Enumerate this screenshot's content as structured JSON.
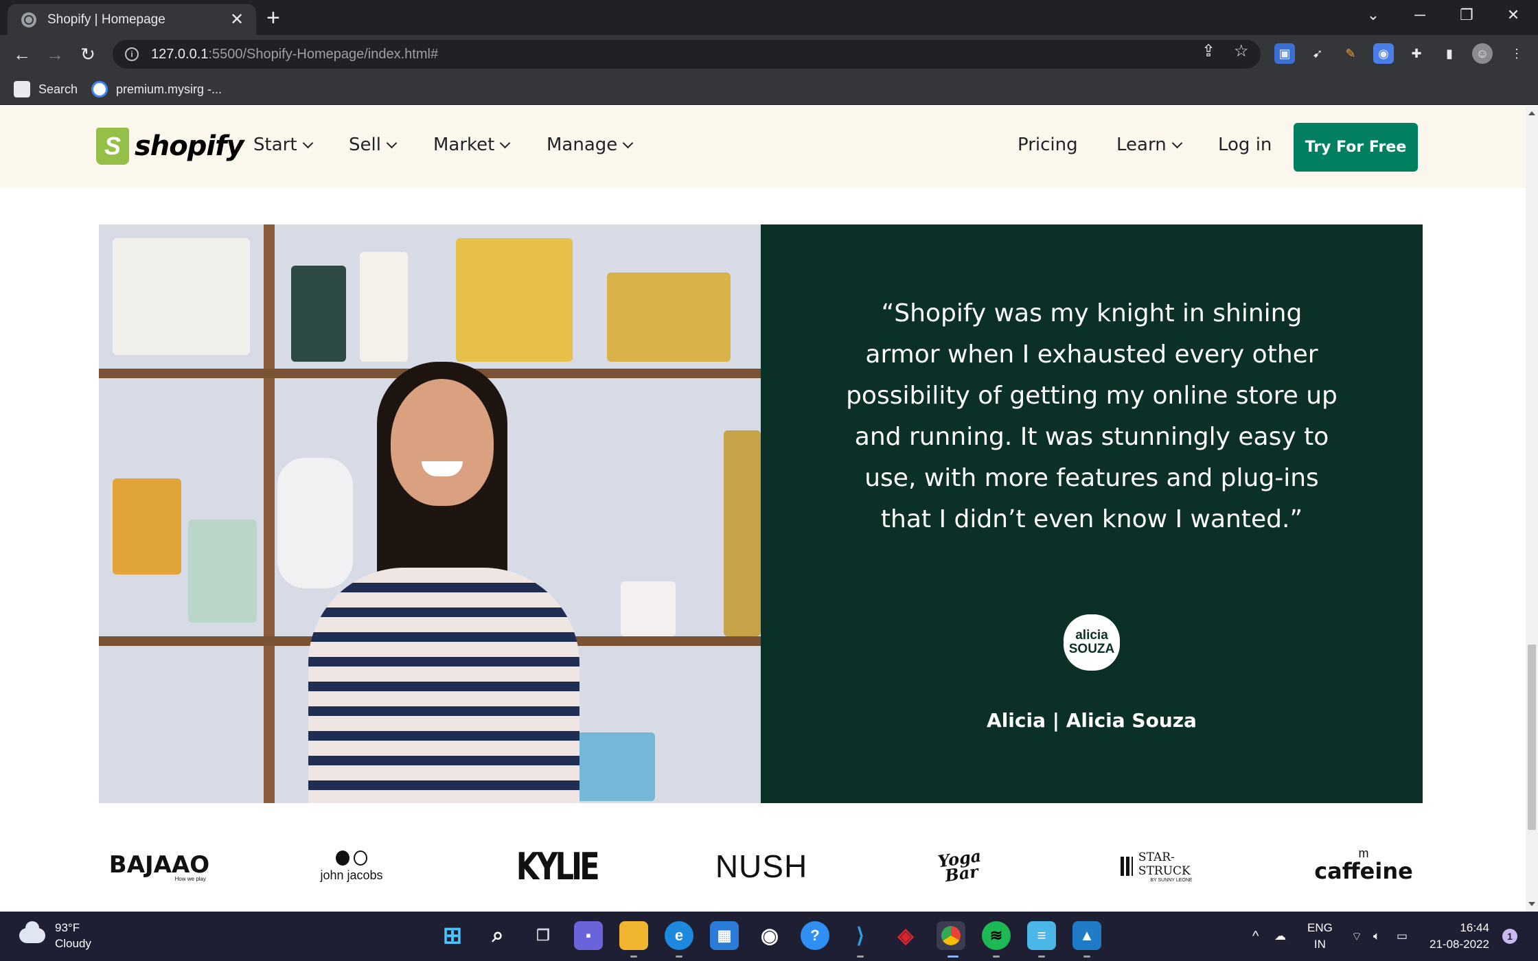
{
  "browser": {
    "tab_title": "Shopify | Homepage",
    "tab_close": "✕",
    "new_tab": "+",
    "url_host": "127.0.0.1",
    "url_path": ":5500/Shopify-Homepage/index.html#",
    "bookmarks": [
      {
        "label": "Search"
      },
      {
        "label": "premium.mysirg -..."
      }
    ]
  },
  "header": {
    "logo_text": "shopify",
    "nav": [
      "Start",
      "Sell",
      "Market",
      "Manage"
    ],
    "right_nav": {
      "pricing": "Pricing",
      "learn": "Learn",
      "login": "Log in"
    },
    "cta": "Try For Free"
  },
  "testimonial": {
    "quote": "“Shopify was my knight in shining armor when I exhausted every other possibility of getting my online store up and running. It was stunningly easy to use, with more features and plug-ins that I didn’t even know I wanted.”",
    "badge_line1": "alicia",
    "badge_line2": "SOUZA",
    "author": "Alicia | Alicia Souza"
  },
  "brands": [
    {
      "name": "BAJAAO",
      "tagline": "How we play"
    },
    {
      "name": "john jacobs"
    },
    {
      "name": "KYLIE"
    },
    {
      "name": "NUSH"
    },
    {
      "name": "Yoga Bar"
    },
    {
      "name": "STAR-STRUCK",
      "tagline": "BY SUNNY LEONE"
    },
    {
      "name": "caffeine",
      "prefix": "m"
    }
  ],
  "taskbar": {
    "temperature": "93°F",
    "condition": "Cloudy",
    "language": "ENG",
    "region": "IN",
    "time": "16:44",
    "date": "21-08-2022",
    "notifications": "1"
  },
  "colors": {
    "shopify_green": "#008060",
    "panel_green": "#0b3027",
    "header_bg": "#fbf7ed"
  }
}
